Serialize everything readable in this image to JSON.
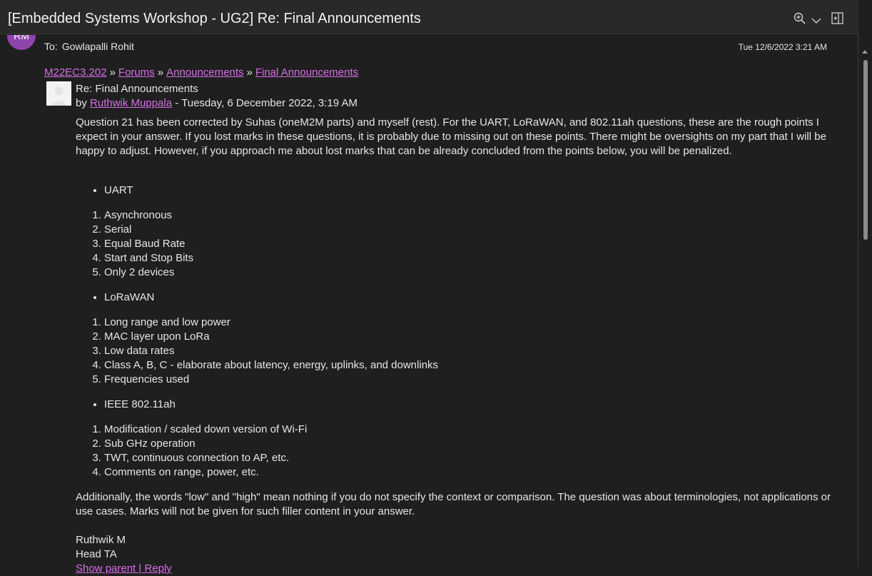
{
  "window": {
    "title": "[Embedded Systems Workshop - UG2] Re: Final Announcements"
  },
  "header": {
    "avatar_initials": "RM",
    "to_label": "To:",
    "to_name": "Gowlapalli Rohit",
    "date": "Tue 12/6/2022 3:21 AM"
  },
  "breadcrumb": {
    "items": [
      "M22EC3.202",
      "Forums",
      "Announcements",
      "Final Announcements"
    ],
    "separator": "»"
  },
  "post": {
    "subject": "Re: Final Announcements",
    "by_prefix": "by",
    "author": "Ruthwik Muppala",
    "date_suffix": "- Tuesday, 6 December 2022, 3:19 AM",
    "intro": "Question 21 has been corrected by Suhas (oneM2M parts) and myself (rest). For the UART, LoRaWAN, and 802.11ah questions, these are the rough points I expect in your answer. If you lost marks in these questions, it is probably due to missing out on these points. There might be oversights on my part that I will be happy to adjust. However, if you approach me about lost marks that can be already concluded from the points below, you will be penalized.",
    "sections": [
      {
        "heading": "UART",
        "points": [
          "Asynchronous",
          "Serial",
          "Equal Baud Rate",
          "Start and Stop Bits",
          "Only 2 devices"
        ]
      },
      {
        "heading": "LoRaWAN",
        "points": [
          "Long range and low power",
          "MAC layer upon LoRa",
          "Low data rates",
          "Class A, B, C - elaborate about latency, energy, uplinks, and downlinks",
          "Frequencies used"
        ]
      },
      {
        "heading": "IEEE 802.11ah",
        "points": [
          "Modification / scaled down version of Wi-Fi",
          "Sub GHz operation",
          "TWT, continuous connection to AP, etc.",
          "Comments on range, power, etc."
        ]
      }
    ],
    "closing": "Additionally, the words \"low\" and \"high\" mean nothing if you do not specify the context or comparison. The question was about terminologies, not applications or use cases. Marks will not be given for such filler content in your answer.",
    "signature_name": "Ruthwik M",
    "signature_role": "Head TA",
    "footer_link": "Show parent | Reply"
  },
  "icons": {
    "zoom": "zoom-in-icon",
    "chevron": "chevron-down-icon",
    "popout": "pop-out-icon"
  },
  "colors": {
    "link": "#d76ee8",
    "avatar": "#8e44ad",
    "background": "#1f1f1f"
  }
}
